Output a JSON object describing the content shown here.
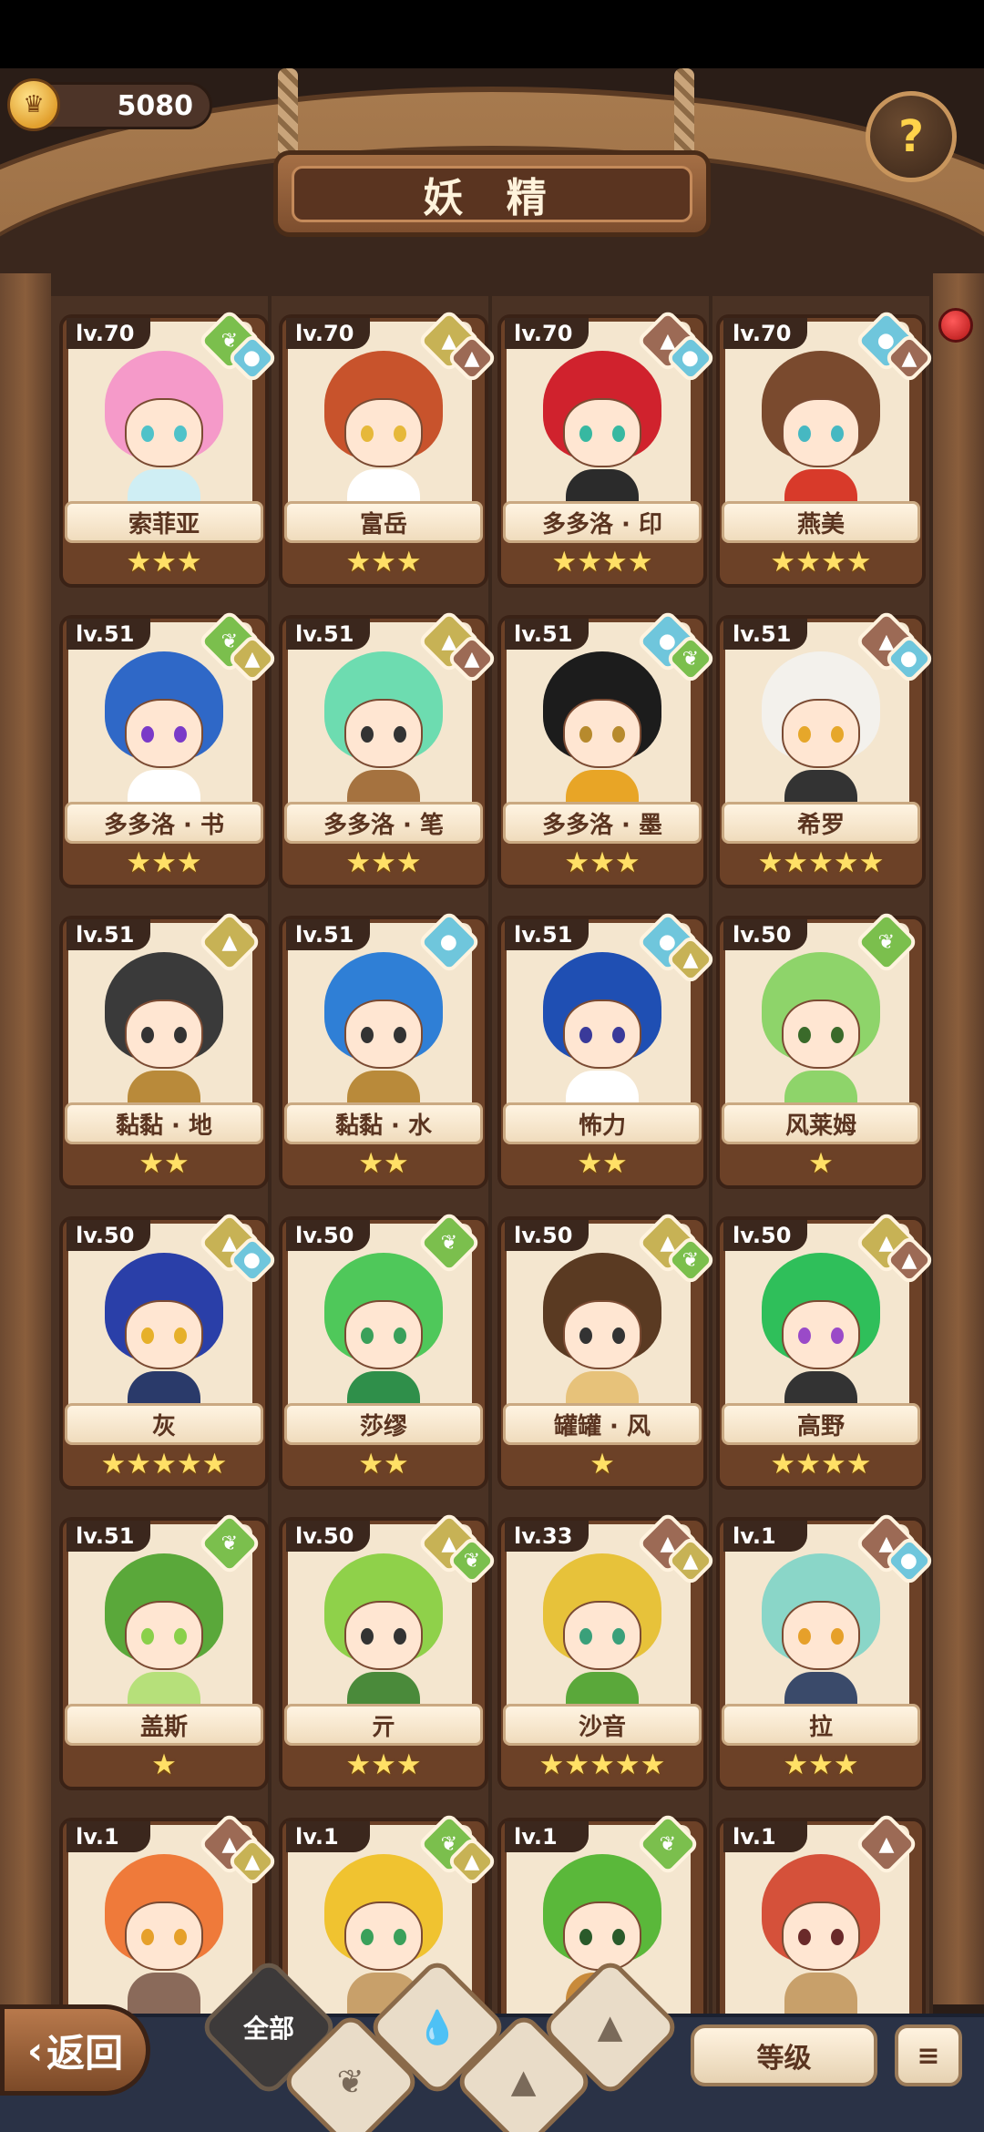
{
  "header": {
    "currency_value": "5080",
    "title": "妖 精"
  },
  "cards": [
    {
      "level": "lv.70",
      "name": "索菲亚",
      "stars": "★★★",
      "elements": [
        "leaf-icon",
        "water-icon"
      ],
      "hair": "#f59ac9",
      "eyes": "#4fc2c9",
      "body": "#cfeef4"
    },
    {
      "level": "lv.70",
      "name": "富岳",
      "stars": "★★★",
      "elements": [
        "earth-icon",
        "fire-icon"
      ],
      "hair": "#c8532c",
      "eyes": "#e6b83a",
      "body": "#ffffff"
    },
    {
      "level": "lv.70",
      "name": "多多洛 · 印",
      "stars": "★★★★",
      "elements": [
        "fire-icon",
        "water-icon"
      ],
      "hair": "#d0222d",
      "eyes": "#37b8a1",
      "body": "#2b2b2b"
    },
    {
      "level": "lv.70",
      "name": "燕美",
      "stars": "★★★★",
      "elements": [
        "water-icon",
        "fire-icon"
      ],
      "hair": "#7a4a2e",
      "eyes": "#46b8c2",
      "body": "#d83a2a"
    },
    {
      "level": "lv.51",
      "name": "多多洛 · 书",
      "stars": "★★★",
      "elements": [
        "leaf-icon",
        "earth-icon"
      ],
      "hair": "#2f68c7",
      "eyes": "#7a3ac8",
      "body": "#ffffff"
    },
    {
      "level": "lv.51",
      "name": "多多洛 · 笔",
      "stars": "★★★",
      "elements": [
        "earth-icon",
        "fire-icon"
      ],
      "hair": "#6ddcb0",
      "eyes": "#333333",
      "body": "#a5723f"
    },
    {
      "level": "lv.51",
      "name": "多多洛 · 墨",
      "stars": "★★★",
      "elements": [
        "water-icon",
        "leaf-icon"
      ],
      "hair": "#1c1c1c",
      "eyes": "#b78a2d",
      "body": "#e8a526"
    },
    {
      "level": "lv.51",
      "name": "希罗",
      "stars": "★★★★★",
      "elements": [
        "fire-icon",
        "water-icon"
      ],
      "hair": "#f3f1ec",
      "eyes": "#e6a72a",
      "body": "#333333"
    },
    {
      "level": "lv.51",
      "name": "黏黏 · 地",
      "stars": "★★",
      "elements": [
        "earth-icon"
      ],
      "hair": "#3a3a3a",
      "eyes": "#333333",
      "body": "#b98a3a"
    },
    {
      "level": "lv.51",
      "name": "黏黏 · 水",
      "stars": "★★",
      "elements": [
        "water-icon"
      ],
      "hair": "#2f7fd6",
      "eyes": "#333333",
      "body": "#b98a3a"
    },
    {
      "level": "lv.51",
      "name": "怖力",
      "stars": "★★",
      "elements": [
        "water-icon",
        "earth-icon"
      ],
      "hair": "#1f4fb3",
      "eyes": "#3a3a9a",
      "body": "#ffffff"
    },
    {
      "level": "lv.50",
      "name": "风莱姆",
      "stars": "★",
      "elements": [
        "leaf-icon"
      ],
      "hair": "#8ed46a",
      "eyes": "#3a6a2a",
      "body": "#8ed46a"
    },
    {
      "level": "lv.50",
      "name": "灰",
      "stars": "★★★★★",
      "elements": [
        "earth-icon",
        "water-icon"
      ],
      "hair": "#2a3fa8",
      "eyes": "#e6b02a",
      "body": "#2a3a6a"
    },
    {
      "level": "lv.50",
      "name": "莎缪",
      "stars": "★★",
      "elements": [
        "leaf-icon"
      ],
      "hair": "#4fc85a",
      "eyes": "#3aa05a",
      "body": "#2f8f4a"
    },
    {
      "level": "lv.50",
      "name": "罐罐 · 风",
      "stars": "★",
      "elements": [
        "earth-icon",
        "leaf-icon"
      ],
      "hair": "#5a3a22",
      "eyes": "#333333",
      "body": "#e7c27a"
    },
    {
      "level": "lv.50",
      "name": "高野",
      "stars": "★★★★",
      "elements": [
        "earth-icon",
        "fire-icon"
      ],
      "hair": "#2fbf5a",
      "eyes": "#9a4ac8",
      "body": "#333333"
    },
    {
      "level": "lv.51",
      "name": "盖斯",
      "stars": "★",
      "elements": [
        "leaf-icon"
      ],
      "hair": "#5aa83a",
      "eyes": "#8ad04a",
      "body": "#b6e07a"
    },
    {
      "level": "lv.50",
      "name": "亓",
      "stars": "★★★",
      "elements": [
        "earth-icon",
        "leaf-icon"
      ],
      "hair": "#8fd14a",
      "eyes": "#333333",
      "body": "#4a8a3a"
    },
    {
      "level": "lv.33",
      "name": "沙音",
      "stars": "★★★★★",
      "elements": [
        "fire-icon",
        "earth-icon"
      ],
      "hair": "#e7c23a",
      "eyes": "#3aa07a",
      "body": "#5aa83a"
    },
    {
      "level": "lv.1",
      "name": "拉",
      "stars": "★★★",
      "elements": [
        "fire-icon",
        "water-icon"
      ],
      "hair": "#8ad6c8",
      "eyes": "#e6a02a",
      "body": "#3a4a6a"
    },
    {
      "level": "lv.1",
      "name": "",
      "stars": "",
      "elements": [
        "fire-icon",
        "earth-icon"
      ],
      "hair": "#ef7a3a",
      "eyes": "#e6a02a",
      "body": "#8a6a5a"
    },
    {
      "level": "lv.1",
      "name": "",
      "stars": "",
      "elements": [
        "leaf-icon",
        "earth-icon"
      ],
      "hair": "#f0c330",
      "eyes": "#3aa05a",
      "body": "#c8a06a"
    },
    {
      "level": "lv.1",
      "name": "",
      "stars": "",
      "elements": [
        "leaf-icon"
      ],
      "hair": "#5ab83a",
      "eyes": "#2a5a2a",
      "body": "#c88a3a"
    },
    {
      "level": "lv.1",
      "name": "",
      "stars": "",
      "elements": [
        "fire-icon"
      ],
      "hair": "#d5513a",
      "eyes": "#6a2a2a",
      "body": "#c8a06a"
    }
  ],
  "footer": {
    "back_label": "返回",
    "filter_all_label": "全部",
    "sort_label": "等级",
    "order_icon": "≡"
  }
}
